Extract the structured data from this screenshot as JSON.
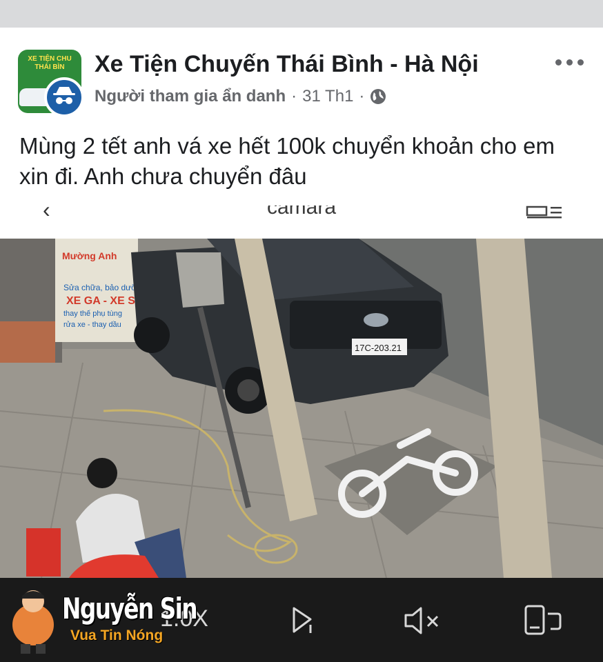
{
  "post": {
    "group_name": "Xe Tiện Chuyến Thái Bình - Hà Nội",
    "author": "Người tham gia ẩn danh",
    "separator": "·",
    "date": "31 Th1",
    "text": "Mùng 2 tết anh vá xe hết 100k chuyển khoản cho em xin đi. Anh chưa chuyển đâu",
    "avatar_banner": "XE TIỆN CHU THÁI BÌN",
    "privacy_icon": "globe-icon"
  },
  "camera": {
    "title": "camara",
    "back_icon": "chevron-left-icon",
    "list_icon": "playlist-icon"
  },
  "scene": {
    "shop_sign_title": "Mường Anh",
    "shop_sign_lines": [
      "Sửa chữa, bảo dưỡng",
      "XE GA - XE S",
      "thay thế phụ tùng",
      "rửa xe - thay dầu"
    ],
    "license_plate": "17C-203.21"
  },
  "player": {
    "speed": "1.0X",
    "icons": [
      "playback-speed-icon",
      "clip-icon",
      "mute-icon",
      "screenshot-icon"
    ]
  },
  "watermark": {
    "name": "Nguyễn Sin",
    "tagline": "Vua Tin Nóng"
  },
  "colors": {
    "text_primary": "#1c1e21",
    "text_secondary": "#65676b",
    "bar_bg": "#1a1a1a",
    "watermark_accent": "#f5a623"
  }
}
